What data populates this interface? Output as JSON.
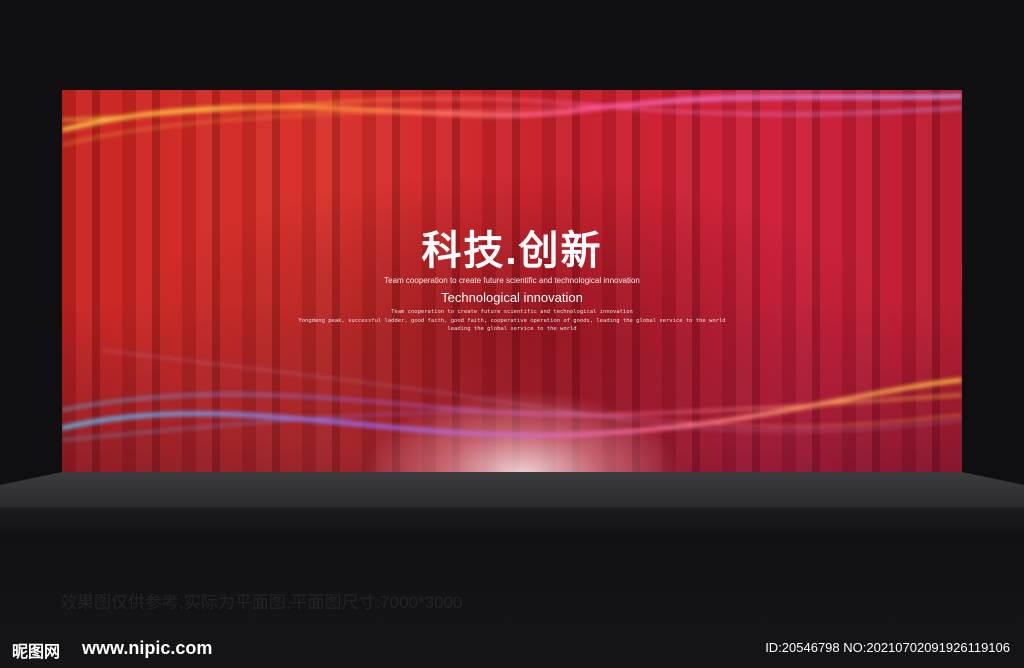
{
  "banner": {
    "title": "科技.创新",
    "tagline": "Team cooperation to create future scientific and technological innovation",
    "subtitle": "Technological innovation",
    "small_line_1": "Team cooperation to create future scientific and technological innovation",
    "small_line_2": "Yongdeng peak, successful ladder, good faith, good faith, cooperative operation of goods, leading the global service to the world",
    "small_line_3": "leading the global service to the world"
  },
  "footer": {
    "note": "效果图仅供参考,实际为平面图,平面图尺寸:7000*3000",
    "logo": "昵图网",
    "site": "www.nipic.com",
    "id": "ID:20546798 NO:20210702091926119106"
  },
  "colors": {
    "banner_red": "#d9302a",
    "stage": "#3a3a3c",
    "background": "#0e0e10"
  }
}
